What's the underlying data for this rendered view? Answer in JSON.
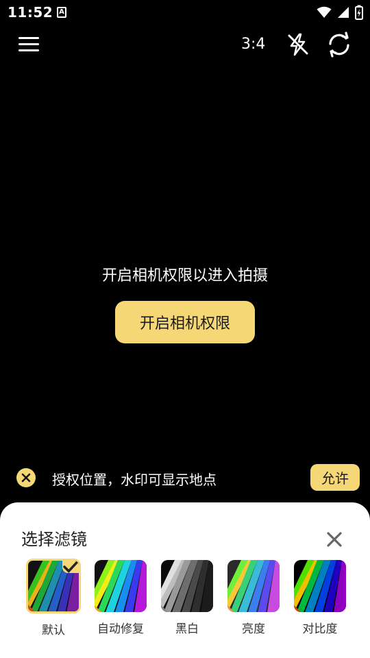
{
  "status_bar": {
    "time": "11:52",
    "notification_icon": "A"
  },
  "toolbar": {
    "aspect_ratio": "3:4"
  },
  "permission": {
    "message": "开启相机权限以进入拍摄",
    "button_label": "开启相机权限"
  },
  "location_prompt": {
    "message": "授权位置，水印可显示地点",
    "allow_label": "允许"
  },
  "filter_sheet": {
    "title": "选择滤镜",
    "filters": [
      {
        "label": "默认",
        "selected": true
      },
      {
        "label": "自动修复",
        "selected": false
      },
      {
        "label": "黑白",
        "selected": false
      },
      {
        "label": "亮度",
        "selected": false
      },
      {
        "label": "对比度",
        "selected": false
      }
    ]
  },
  "colors": {
    "accent": "#f5d775",
    "background": "#000000",
    "sheet": "#ffffff"
  }
}
